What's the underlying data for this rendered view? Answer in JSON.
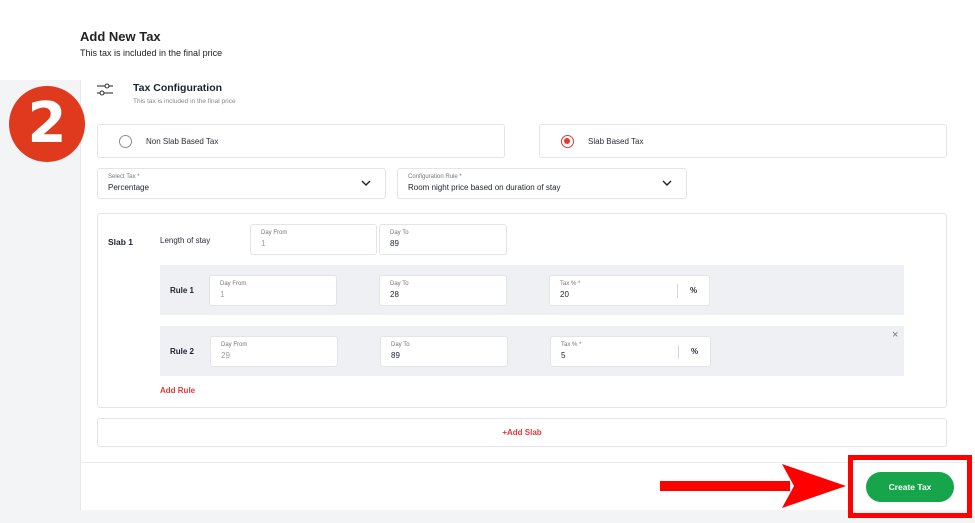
{
  "header": {
    "title": "Add New Tax",
    "subtitle": "This tax is included in the final price"
  },
  "step_badge": {
    "number": "2",
    "color": "#e03a1e"
  },
  "config": {
    "title": "Tax Configuration",
    "subtitle": "This tax is included in the final price",
    "icon": "sliders-icon"
  },
  "tax_type": {
    "options": [
      {
        "label": "Non Slab Based Tax",
        "selected": false
      },
      {
        "label": "Slab Based Tax",
        "selected": true
      }
    ]
  },
  "select_tax": {
    "label": "Select Tax *",
    "value": "Percentage"
  },
  "configuration_rule": {
    "label": "Configuration Rule *",
    "value": "Room night price based on duration of stay"
  },
  "slab": {
    "name": "Slab 1",
    "length_label": "Length of stay",
    "day_from": {
      "label": "Day From",
      "value": "1"
    },
    "day_to": {
      "label": "Day To",
      "value": "89"
    },
    "rules": [
      {
        "name": "Rule 1",
        "day_from": {
          "label": "Day From",
          "value": "1"
        },
        "day_to": {
          "label": "Day To",
          "value": "28"
        },
        "tax": {
          "label": "Tax % *",
          "value": "20",
          "unit": "%"
        }
      },
      {
        "name": "Rule 2",
        "day_from": {
          "label": "Day From",
          "value": "29"
        },
        "day_to": {
          "label": "Day To",
          "value": "89"
        },
        "tax": {
          "label": "Tax % *",
          "value": "5",
          "unit": "%"
        }
      }
    ],
    "remove_icon": "×",
    "add_rule_label": "Add Rule"
  },
  "add_slab_label": "+Add Slab",
  "create_button": {
    "label": "Create Tax",
    "color": "#16a54a"
  },
  "colors": {
    "accent_red": "#e53935",
    "highlight_red": "#ff0000"
  }
}
